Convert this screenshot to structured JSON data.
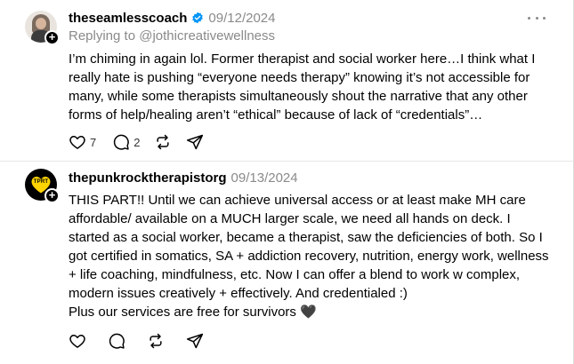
{
  "posts": [
    {
      "username": "theseamlesscoach",
      "verified": true,
      "date": "09/12/2024",
      "replying_to": "Replying to @jothicreativewellness",
      "body": "I’m chiming in again lol. Former therapist and social worker here…I think what I really hate is pushing “everyone needs therapy” knowing it’s not accessible for many, while some therapists simultaneously shout the narrative that any other forms of help/healing aren’t “ethical” because of lack of “credentials”…",
      "likes": "7",
      "comments": "2",
      "follow_badge": "+"
    },
    {
      "username": "thepunkrocktherapistorg",
      "verified": false,
      "date": "09/13/2024",
      "avatar_text": "TPRT",
      "body": "THIS PART!! Until we can achieve universal access or at least make MH care affordable/ available on a MUCH larger scale, we need all hands on deck. I started as a social worker, became a therapist, saw the deficiencies of both. So I got certified in somatics, SA + addiction recovery, nutrition, energy work, wellness + life coaching, mindfulness, etc. Now I can offer a blend to work w complex, modern issues creatively + effectively. And credentialed :)",
      "body_line2": "Plus our services are free for survivors 🖤",
      "follow_badge": "+"
    }
  ],
  "colors": {
    "verified_blue": "#0095f6",
    "muted_text": "#8a8a8a",
    "avatar_heart": "#ffd400",
    "divider": "#e6e6e6"
  },
  "icons": {
    "like": "heart-outline-icon",
    "comment": "speech-bubble-icon",
    "repost": "repost-arrows-icon",
    "share": "paper-plane-icon",
    "more": "more-horizontal-icon"
  }
}
